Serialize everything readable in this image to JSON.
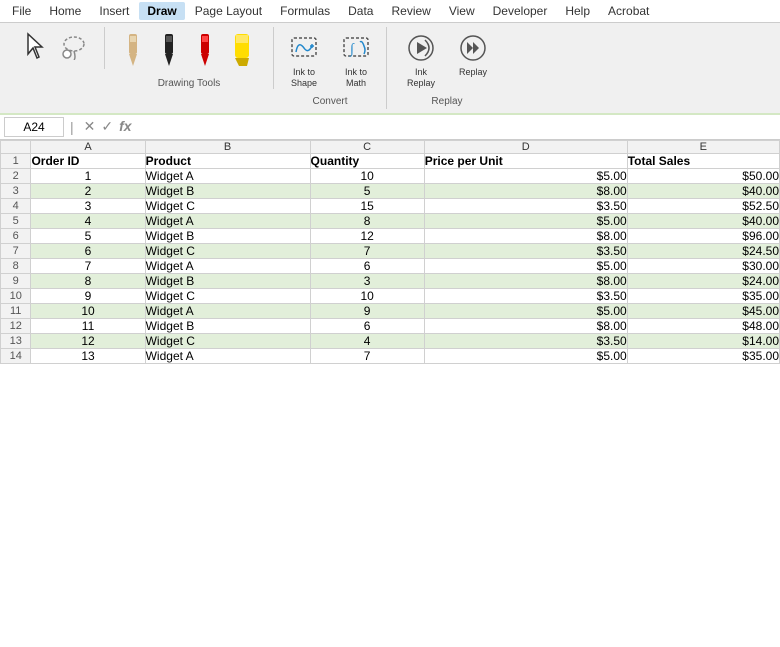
{
  "menubar": {
    "items": [
      "File",
      "Home",
      "Insert",
      "Draw",
      "Page Layout",
      "Formulas",
      "Data",
      "Review",
      "View",
      "Developer",
      "Help",
      "Acrobat"
    ],
    "active": "Draw"
  },
  "ribbon": {
    "groups": [
      {
        "name": "Drawing Tools",
        "tools": [
          {
            "id": "select",
            "icon": "cursor",
            "label": ""
          },
          {
            "id": "lasso",
            "icon": "lasso",
            "label": ""
          }
        ]
      },
      {
        "name": "Drawing Tools",
        "tools": [
          {
            "id": "pen-beige",
            "icon": "pen-beige",
            "label": ""
          },
          {
            "id": "pen-black",
            "icon": "pen-black",
            "label": ""
          },
          {
            "id": "pen-red",
            "icon": "pen-red",
            "label": ""
          },
          {
            "id": "pen-yellow",
            "icon": "pen-yellow",
            "label": ""
          }
        ],
        "label": "Drawing Tools"
      }
    ],
    "convert": {
      "label": "Convert",
      "ink_to_shape_label": "Ink to\nShape",
      "ink_to_math_label": "Ink to\nMath"
    },
    "replay": {
      "label": "Replay",
      "ink_replay_label": "Ink\nReplay",
      "replay_label": "Replay"
    }
  },
  "formula_bar": {
    "cell_ref": "A24",
    "formula": ""
  },
  "spreadsheet": {
    "columns": [
      "A",
      "B",
      "C",
      "D",
      "E"
    ],
    "column_widths": [
      "90px",
      "130px",
      "90px",
      "160px",
      "120px"
    ],
    "header_row": {
      "row_num": "1",
      "cells": [
        "Order ID",
        "Product",
        "Quantity",
        "Price per Unit",
        "Total Sales"
      ]
    },
    "rows": [
      {
        "row_num": "2",
        "color": "white",
        "cells": [
          "1",
          "Widget A",
          "10",
          "$5.00",
          "$50.00"
        ]
      },
      {
        "row_num": "3",
        "color": "green",
        "cells": [
          "2",
          "Widget B",
          "5",
          "$8.00",
          "$40.00"
        ]
      },
      {
        "row_num": "4",
        "color": "white",
        "cells": [
          "3",
          "Widget C",
          "15",
          "$3.50",
          "$52.50"
        ]
      },
      {
        "row_num": "5",
        "color": "green",
        "cells": [
          "4",
          "Widget A",
          "8",
          "$5.00",
          "$40.00"
        ]
      },
      {
        "row_num": "6",
        "color": "white",
        "cells": [
          "5",
          "Widget B",
          "12",
          "$8.00",
          "$96.00"
        ]
      },
      {
        "row_num": "7",
        "color": "green",
        "cells": [
          "6",
          "Widget C",
          "7",
          "$3.50",
          "$24.50"
        ]
      },
      {
        "row_num": "8",
        "color": "white",
        "cells": [
          "7",
          "Widget A",
          "6",
          "$5.00",
          "$30.00"
        ]
      },
      {
        "row_num": "9",
        "color": "green",
        "cells": [
          "8",
          "Widget B",
          "3",
          "$8.00",
          "$24.00"
        ]
      },
      {
        "row_num": "10",
        "color": "white",
        "cells": [
          "9",
          "Widget C",
          "10",
          "$3.50",
          "$35.00"
        ]
      },
      {
        "row_num": "11",
        "color": "green",
        "cells": [
          "10",
          "Widget A",
          "9",
          "$5.00",
          "$45.00"
        ]
      },
      {
        "row_num": "12",
        "color": "white",
        "cells": [
          "11",
          "Widget B",
          "6",
          "$8.00",
          "$48.00"
        ]
      },
      {
        "row_num": "13",
        "color": "green",
        "cells": [
          "12",
          "Widget C",
          "4",
          "$3.50",
          "$14.00"
        ]
      },
      {
        "row_num": "14",
        "color": "white",
        "cells": [
          "13",
          "Widget A",
          "7",
          "$5.00",
          "$35.00"
        ]
      }
    ]
  }
}
